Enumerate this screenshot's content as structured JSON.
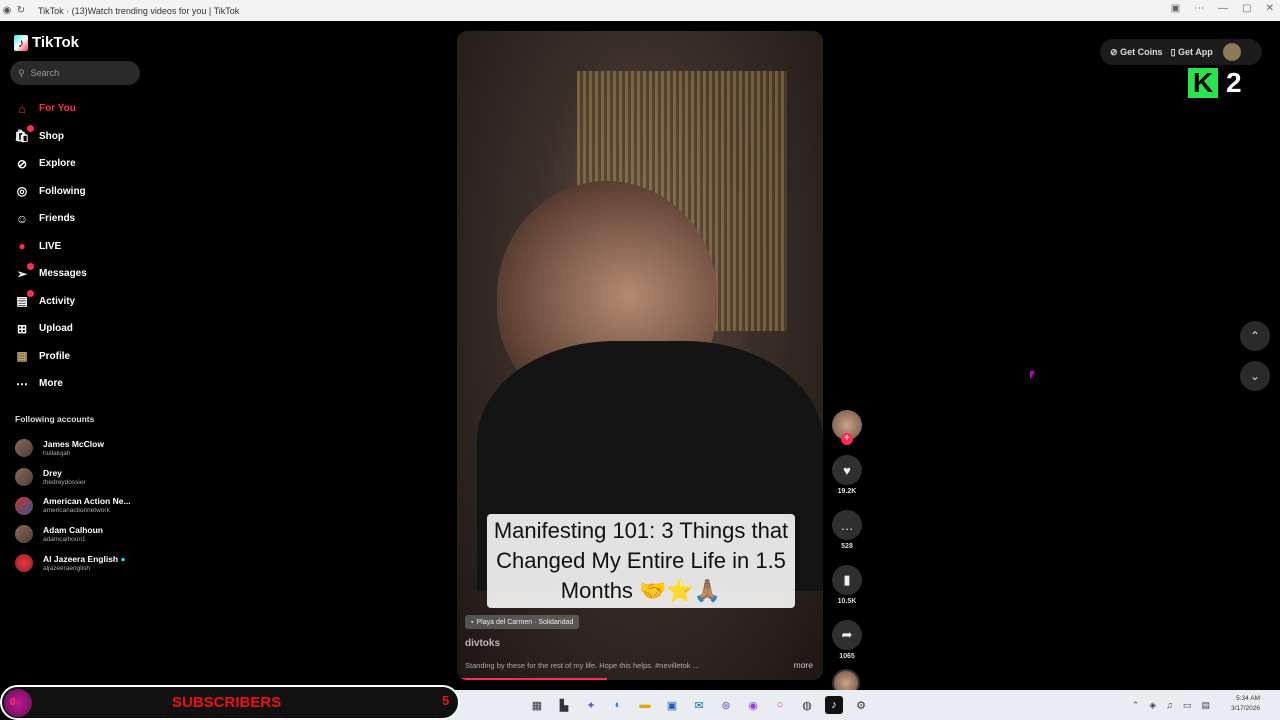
{
  "window": {
    "title": "TikTok · (13)Watch trending videos for you | TikTok"
  },
  "sidebar": {
    "logo": "TikTok",
    "search_placeholder": "Search",
    "nav": [
      {
        "label": "For You",
        "icon": "home-icon"
      },
      {
        "label": "Shop",
        "icon": "shopping-bag-icon"
      },
      {
        "label": "Explore",
        "icon": "compass-icon"
      },
      {
        "label": "Following",
        "icon": "following-avatar-icon"
      },
      {
        "label": "Friends",
        "icon": "friends-icon"
      },
      {
        "label": "LIVE",
        "icon": "live-icon"
      },
      {
        "label": "Messages",
        "icon": "paper-plane-icon"
      },
      {
        "label": "Activity",
        "icon": "activity-icon"
      },
      {
        "label": "Upload",
        "icon": "plus-square-icon"
      },
      {
        "label": "Profile",
        "icon": "profile-avatar-icon"
      },
      {
        "label": "More",
        "icon": "ellipsis-icon"
      }
    ],
    "following_title": "Following accounts",
    "following": [
      {
        "name": "James McClow",
        "handle": "hullalujah"
      },
      {
        "name": "Drey",
        "handle": "thedreydossier"
      },
      {
        "name": "American Action Ne...",
        "handle": "americanactionnetwork"
      },
      {
        "name": "Adam Calhoun",
        "handle": "adamcalhoun1"
      },
      {
        "name": "Al Jazeera English",
        "handle": "aljazeeraenglish"
      }
    ]
  },
  "video": {
    "caption": "Manifesting 101: 3 Things that Changed My Entire Life in 1.5 Months 🤝⭐🙏🏽",
    "location": "Playa del Carmen · Solidaridad",
    "author": "divtoks",
    "description": "Standing by these for the rest of my life. Hope this helps. #nevilletok ...",
    "more": "more",
    "progress": 0.41
  },
  "actions": {
    "likes": "19.2K",
    "comments": "528",
    "saves": "10.5K",
    "shares": "1065"
  },
  "topbar": {
    "coins": "Get Coins",
    "app": "Get App"
  },
  "overlay": {
    "k_letter": "K",
    "k_number": "2",
    "subscribers_label": "SUBSCRIBERS",
    "subscribers_count": "5",
    "badge_digit": "0"
  },
  "taskbar": {
    "time": "5:34 AM",
    "date": "3/17/2026"
  }
}
